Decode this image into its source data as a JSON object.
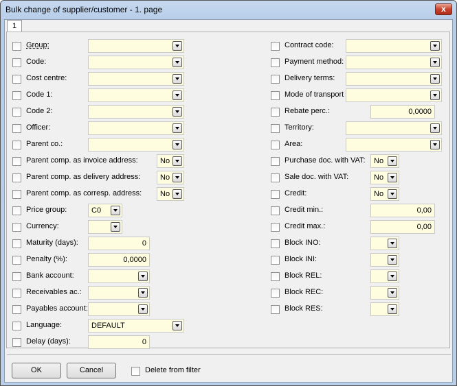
{
  "window": {
    "title": "Bulk change of supplier/customer - 1. page",
    "close_label": "x"
  },
  "tab": {
    "label": "1"
  },
  "left": [
    {
      "key": "group",
      "label": "Group:",
      "kind": "combo",
      "value": ""
    },
    {
      "key": "code",
      "label": "Code:",
      "kind": "combo",
      "value": ""
    },
    {
      "key": "cost-centre",
      "label": "Cost centre:",
      "kind": "combo",
      "value": ""
    },
    {
      "key": "code-1",
      "label": "Code 1:",
      "kind": "combo",
      "value": ""
    },
    {
      "key": "code-2",
      "label": "Code 2:",
      "kind": "combo",
      "value": ""
    },
    {
      "key": "officer",
      "label": "Officer:",
      "kind": "combo",
      "value": ""
    },
    {
      "key": "parent-co",
      "label": "Parent co.:",
      "kind": "combo",
      "value": ""
    },
    {
      "key": "parent-invoice",
      "label": "Parent comp. as invoice address:",
      "kind": "small",
      "value": "No"
    },
    {
      "key": "parent-delivery",
      "label": "Parent comp. as delivery address:",
      "kind": "small",
      "value": "No"
    },
    {
      "key": "parent-corresp",
      "label": "Parent comp. as corresp. address:",
      "kind": "small",
      "value": "No"
    },
    {
      "key": "price-group",
      "label": "Price group:",
      "kind": "tiny",
      "value": "C0"
    },
    {
      "key": "currency",
      "label": "Currency:",
      "kind": "tiny",
      "value": ""
    },
    {
      "key": "maturity",
      "label": "Maturity (days):",
      "kind": "num",
      "value": "0"
    },
    {
      "key": "penalty",
      "label": "Penalty (%):",
      "kind": "num",
      "value": "0,0000"
    },
    {
      "key": "bank-account",
      "label": "Bank account:",
      "kind": "mid",
      "value": ""
    },
    {
      "key": "receivables",
      "label": "Receivables ac.:",
      "kind": "mid",
      "value": ""
    },
    {
      "key": "payables",
      "label": "Payables account:",
      "kind": "mid",
      "value": ""
    },
    {
      "key": "language",
      "label": "Language:",
      "kind": "lang",
      "value": "DEFAULT"
    },
    {
      "key": "delay",
      "label": "Delay (days):",
      "kind": "num",
      "value": "0"
    }
  ],
  "right": [
    {
      "key": "contract-code",
      "label": "Contract code:",
      "kind": "combo",
      "value": ""
    },
    {
      "key": "payment-method",
      "label": "Payment method:",
      "kind": "combo",
      "value": ""
    },
    {
      "key": "delivery-terms",
      "label": "Delivery terms:",
      "kind": "combo",
      "value": ""
    },
    {
      "key": "mode-of-transport",
      "label": "Mode of transport",
      "kind": "combo",
      "value": ""
    },
    {
      "key": "rebate",
      "label": "Rebate perc.:",
      "kind": "num",
      "value": "0,0000"
    },
    {
      "key": "territory",
      "label": "Territory:",
      "kind": "combo",
      "value": ""
    },
    {
      "key": "area",
      "label": "Area:",
      "kind": "combo",
      "value": ""
    },
    {
      "key": "purchase-vat",
      "label": "Purchase doc. with VAT:",
      "kind": "small",
      "value": "No"
    },
    {
      "key": "sale-vat",
      "label": "Sale doc. with VAT:",
      "kind": "small",
      "value": "No"
    },
    {
      "key": "credit",
      "label": "Credit:",
      "kind": "small",
      "value": "No"
    },
    {
      "key": "credit-min",
      "label": "Credit min.:",
      "kind": "num",
      "value": "0,00"
    },
    {
      "key": "credit-max",
      "label": "Credit max.:",
      "kind": "num",
      "value": "0,00"
    },
    {
      "key": "block-ino",
      "label": "Block INO:",
      "kind": "small",
      "value": ""
    },
    {
      "key": "block-ini",
      "label": "Block INI:",
      "kind": "small",
      "value": ""
    },
    {
      "key": "block-rel",
      "label": "Block REL:",
      "kind": "small",
      "value": ""
    },
    {
      "key": "block-rec",
      "label": "Block REC:",
      "kind": "small",
      "value": ""
    },
    {
      "key": "block-res",
      "label": "Block RES:",
      "kind": "small",
      "value": ""
    }
  ],
  "footer": {
    "ok_label": "OK",
    "cancel_label": "Cancel",
    "delete_from_filter_label": "Delete from filter"
  }
}
